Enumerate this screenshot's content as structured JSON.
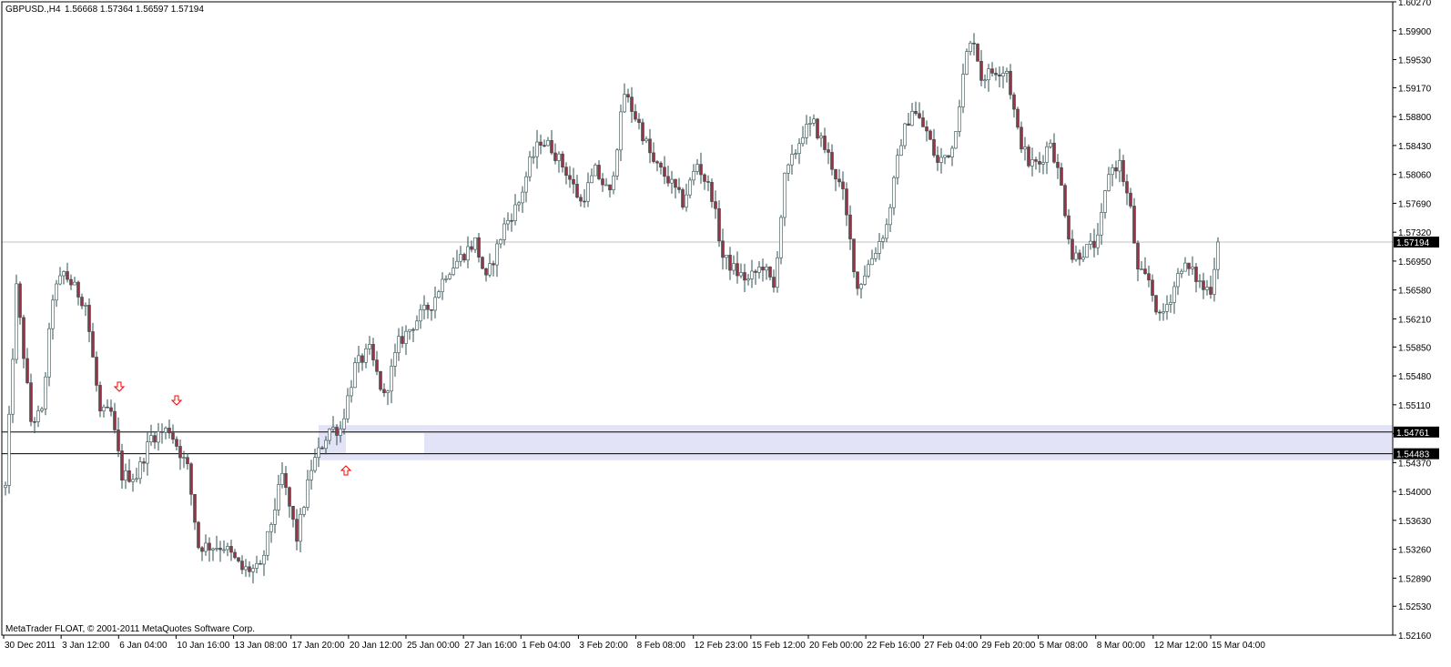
{
  "header": {
    "symbol_timeframe": "GBPUSD.,H4",
    "ohlc": "1.56668 1.57364 1.56597 1.57194"
  },
  "footer": {
    "copyright": "MetaTrader FLOAT, © 2001-2011 MetaQuotes Software Corp."
  },
  "colors": {
    "bull_body": "#ffffff",
    "bear_body": "#993344",
    "wick": "#2f4f4f",
    "zone_fill": "#e3e3f8",
    "arrow": "#ff0000",
    "grid_line": "#000000",
    "current_price_line": "#c0c0c0"
  },
  "chart_data": {
    "type": "candlestick",
    "symbol": "GBPUSD.",
    "timeframe": "H4",
    "ylim": [
      1.5216,
      1.6027
    ],
    "y_ticks": [
      "1.60270",
      "1.59900",
      "1.59530",
      "1.59170",
      "1.58800",
      "1.58430",
      "1.58060",
      "1.57690",
      "1.57320",
      "1.56950",
      "1.56580",
      "1.56210",
      "1.55850",
      "1.55480",
      "1.55110",
      "1.54740",
      "1.54370",
      "1.54000",
      "1.53630",
      "1.53260",
      "1.52890",
      "1.52530",
      "1.52160"
    ],
    "x_ticks": [
      "30 Dec 2011",
      "3 Jan 12:00",
      "6 Jan 04:00",
      "10 Jan 16:00",
      "13 Jan 08:00",
      "17 Jan 20:00",
      "20 Jan 12:00",
      "25 Jan 00:00",
      "27 Jan 16:00",
      "1 Feb 04:00",
      "3 Feb 20:00",
      "8 Feb 08:00",
      "12 Feb 23:00",
      "15 Feb 12:00",
      "20 Feb 00:00",
      "22 Feb 16:00",
      "27 Feb 04:00",
      "29 Feb 20:00",
      "5 Mar 08:00",
      "8 Mar 00:00",
      "12 Mar 12:00",
      "15 Mar 04:00"
    ],
    "price_labels": {
      "current": "1.57194",
      "level_upper": "1.54761",
      "level_lower": "1.54483"
    },
    "levels": {
      "upper": 1.54761,
      "lower": 1.54483
    },
    "zone": {
      "low": 1.544,
      "high": 1.5485
    },
    "anchors": [
      [
        0,
        1.5405
      ],
      [
        3,
        1.566
      ],
      [
        7,
        1.549
      ],
      [
        10,
        1.55
      ],
      [
        13,
        1.565
      ],
      [
        16,
        1.568
      ],
      [
        22,
        1.564
      ],
      [
        26,
        1.55
      ],
      [
        29,
        1.55
      ],
      [
        32,
        1.542
      ],
      [
        36,
        1.542
      ],
      [
        40,
        1.547
      ],
      [
        45,
        1.548
      ],
      [
        50,
        1.543
      ],
      [
        53,
        1.533
      ],
      [
        60,
        1.533
      ],
      [
        65,
        1.53
      ],
      [
        70,
        1.53
      ],
      [
        76,
        1.542
      ],
      [
        80,
        1.534
      ],
      [
        84,
        1.543
      ],
      [
        89,
        1.548
      ],
      [
        92,
        1.548
      ],
      [
        96,
        1.556
      ],
      [
        100,
        1.558
      ],
      [
        104,
        1.552
      ],
      [
        108,
        1.559
      ],
      [
        113,
        1.562
      ],
      [
        117,
        1.564
      ],
      [
        121,
        1.568
      ],
      [
        125,
        1.57
      ],
      [
        129,
        1.572
      ],
      [
        132,
        1.567
      ],
      [
        137,
        1.574
      ],
      [
        141,
        1.577
      ],
      [
        144,
        1.582
      ],
      [
        147,
        1.585
      ],
      [
        150,
        1.584
      ],
      [
        154,
        1.581
      ],
      [
        158,
        1.577
      ],
      [
        162,
        1.581
      ],
      [
        166,
        1.578
      ],
      [
        170,
        1.591
      ],
      [
        174,
        1.587
      ],
      [
        178,
        1.582
      ],
      [
        182,
        1.58
      ],
      [
        186,
        1.577
      ],
      [
        190,
        1.582
      ],
      [
        194,
        1.578
      ],
      [
        197,
        1.57
      ],
      [
        201,
        1.568
      ],
      [
        204,
        1.567
      ],
      [
        208,
        1.569
      ],
      [
        211,
        1.566
      ],
      [
        214,
        1.58
      ],
      [
        219,
        1.586
      ],
      [
        222,
        1.587
      ],
      [
        226,
        1.583
      ],
      [
        230,
        1.578
      ],
      [
        234,
        1.566
      ],
      [
        238,
        1.57
      ],
      [
        242,
        1.574
      ],
      [
        246,
        1.585
      ],
      [
        249,
        1.589
      ],
      [
        253,
        1.586
      ],
      [
        256,
        1.582
      ],
      [
        260,
        1.584
      ],
      [
        264,
        1.596
      ],
      [
        266,
        1.598
      ],
      [
        268,
        1.593
      ],
      [
        272,
        1.594
      ],
      [
        275,
        1.594
      ],
      [
        278,
        1.586
      ],
      [
        281,
        1.582
      ],
      [
        284,
        1.582
      ],
      [
        287,
        1.585
      ],
      [
        290,
        1.579
      ],
      [
        293,
        1.57
      ],
      [
        297,
        1.571
      ],
      [
        300,
        1.572
      ],
      [
        303,
        1.581
      ],
      [
        306,
        1.582
      ],
      [
        309,
        1.576
      ],
      [
        311,
        1.568
      ],
      [
        314,
        1.567
      ],
      [
        317,
        1.562
      ],
      [
        320,
        1.565
      ],
      [
        323,
        1.569
      ],
      [
        326,
        1.568
      ],
      [
        329,
        1.566
      ],
      [
        331,
        1.566
      ],
      [
        333,
        1.5719
      ]
    ]
  }
}
